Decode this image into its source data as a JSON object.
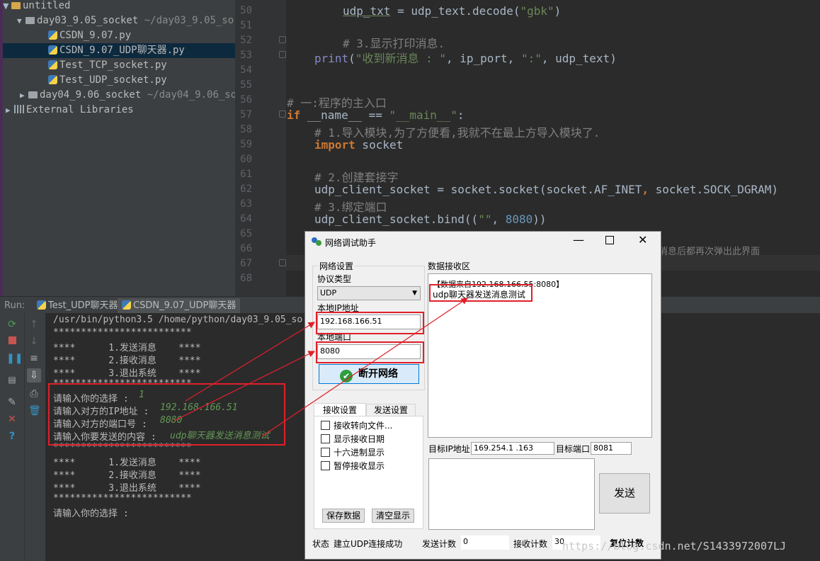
{
  "project": {
    "root": "untitled",
    "items": [
      {
        "label": "day03_9.05_socket",
        "path": "~/day03_9.05_so"
      },
      {
        "label": "CSDN_9.07.py"
      },
      {
        "label": "CSDN_9.07_UDP聊天器.py"
      },
      {
        "label": "Test_TCP_socket.py"
      },
      {
        "label": "Test_UDP_socket.py"
      },
      {
        "label": "day04_9.06_socket",
        "path": "~/day04_9.06_so"
      },
      {
        "label": "External Libraries"
      }
    ]
  },
  "editor": {
    "line_numbers": [
      "50",
      "51",
      "52",
      "53",
      "54",
      "55",
      "56",
      "57",
      "58",
      "59",
      "60",
      "61",
      "62",
      "63",
      "64",
      "65",
      "66",
      "67",
      "68"
    ],
    "l50a": "udp_txt",
    "l50b": " = udp_text.decode(",
    "l50c": "\"gbk\"",
    "l50d": ")",
    "l52": "# 3.显示打印消息.",
    "l53a": "print",
    "l53b": "(",
    "l53c": "\"收到新消息 : \"",
    "l53d": ", ip_port, ",
    "l53e": "\":\"",
    "l53f": ", udp_text)",
    "l56": "# 一:程序的主入口",
    "l57a": "if",
    "l57b": " __name__ == ",
    "l57c": "\"__main__\"",
    "l57d": ":",
    "l58": "# 1.导入模块,为了方便看,我就不在最上方导入模块了.",
    "l59a": "import",
    "l59b": " socket",
    "l61": "# 2.创建套接字",
    "l62a": "udp_client_socket = socket.socket(socket.AF_INET",
    "l62b": ",",
    "l62c": " socket.SOCK_DGRAM)",
    "l63": "# 3.绑定端口",
    "l64a": "udp_client_socket.bind((",
    "l64b": "\"\"",
    "l64c": ", ",
    "l64d": "8080",
    "l64e": "))",
    "l66": "消息后都再次弹出此界面"
  },
  "run": {
    "label": "Run:",
    "tabs": [
      "Test_UDP聊天器",
      "CSDN_9.07_UDP聊天器"
    ],
    "lines": [
      "/usr/bin/python3.5 /home/python/day03_9.05_so",
      "*************************",
      "****      1.发送消息    ****",
      "****      2.接收消息    ****",
      "****      3.退出系统    ****",
      "*************************",
      "请输入你的选择 : ",
      "请输入对方的IP地址 : ",
      "请输入对方的端口号 : ",
      "请输入你要发送的内容 : ",
      "*************************",
      "****      1.发送消息    ****",
      "****      2.接收消息    ****",
      "****      3.退出系统    ****",
      "*************************",
      "请输入你的选择 :"
    ],
    "inputs": [
      "1",
      "192.168.166.51",
      "8080",
      "udp聊天器发送消息测试"
    ]
  },
  "dialog": {
    "title": "网络调试助手",
    "net_settings": "网络设置",
    "protocol_label": "协议类型",
    "protocol_value": "UDP",
    "local_ip_label": "本地IP地址",
    "local_ip": "192.168.166.51",
    "local_port_label": "本地端口",
    "local_port": "8080",
    "disconnect": "断开网络",
    "tab_recv": "接收设置",
    "tab_send": "发送设置",
    "checks": [
      "接收转向文件...",
      "显示接收日期",
      "十六进制显示",
      "暂停接收显示"
    ],
    "save": "保存数据",
    "clear": "清空显示",
    "recv_area_label": "数据接收区",
    "recv_header": "【数据来自192.168.166.55:8080】",
    "recv_msg": "udp聊天器发送消息测试",
    "target_ip_label": "目标IP地址",
    "target_ip": "169.254.1 .163",
    "target_port_label": "目标端口",
    "target_port": "8081",
    "send": "发送",
    "status_label": "状态",
    "status": "建立UDP连接成功",
    "send_count_label": "发送计数",
    "send_count": "0",
    "recv_count_label": "接收计数",
    "recv_count": "30",
    "reset_count": "复位计数"
  },
  "watermark": "https://blog.csdn.net/S1433972007LJ",
  "colors": {
    "highlight": "#e0202a",
    "accent": "#0078d7"
  }
}
